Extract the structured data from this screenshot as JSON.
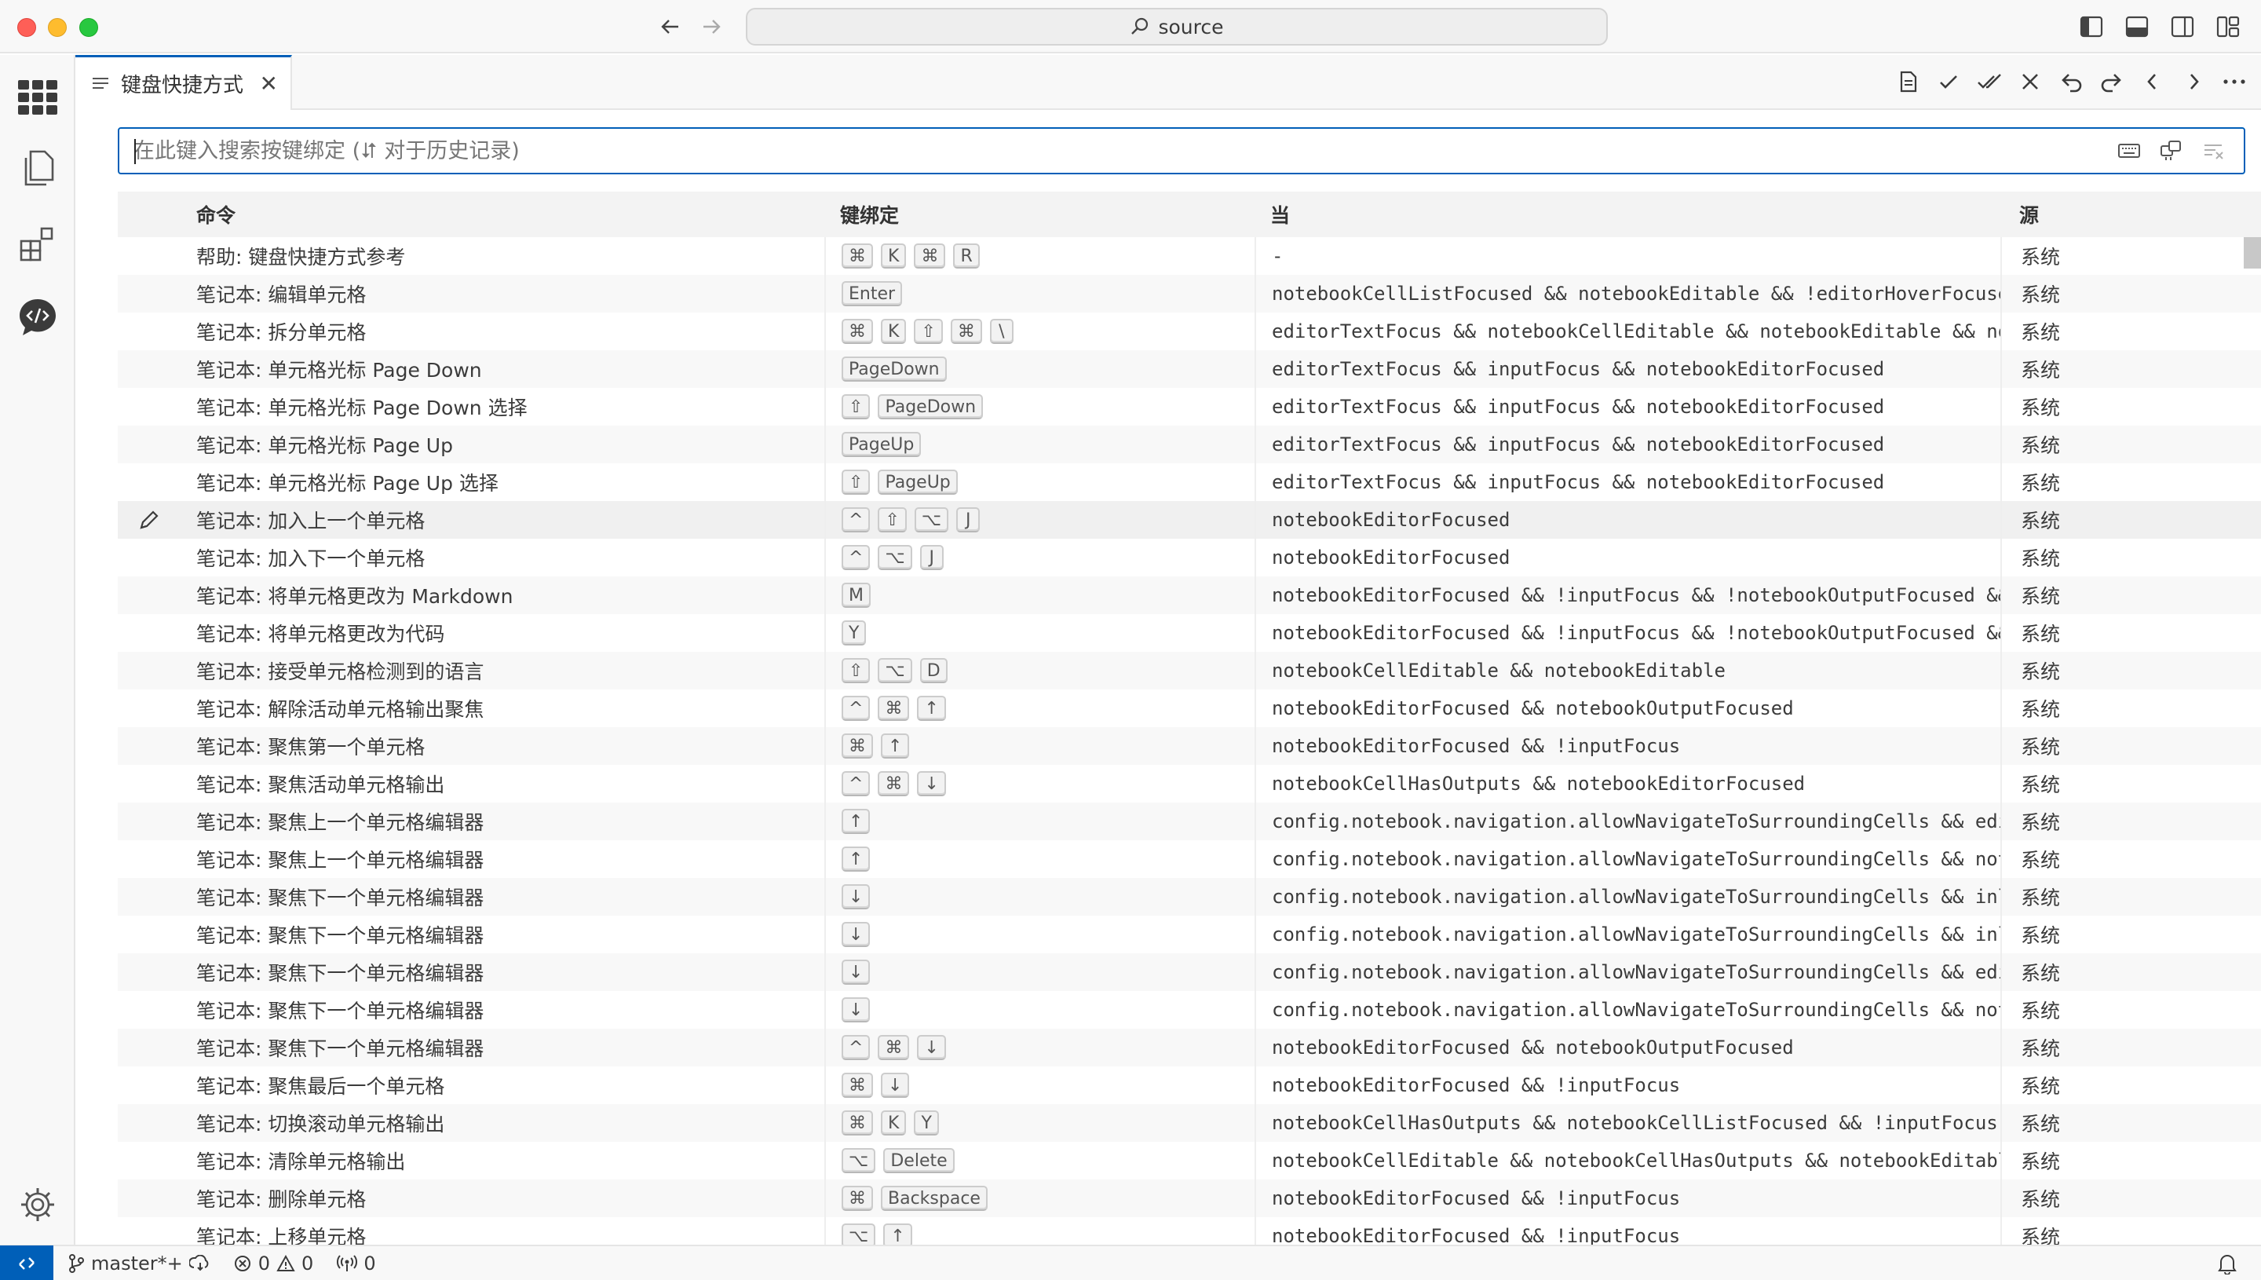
{
  "window": {
    "command_center": "source"
  },
  "tab": {
    "title": "键盘快捷方式"
  },
  "search": {
    "placeholder": "在此键入搜索按键绑定 (⮃ 对于历史记录)",
    "value": ""
  },
  "table": {
    "headers": {
      "command": "命令",
      "keybinding": "键绑定",
      "when": "当",
      "source": "源"
    },
    "rows": [
      {
        "command": "帮助: 键盘快捷方式参考",
        "keys": [
          "⌘",
          "K",
          "⌘",
          "R"
        ],
        "when": "-",
        "source": "系统"
      },
      {
        "command": "笔记本: 编辑单元格",
        "keys": [
          "Enter"
        ],
        "when": "notebookCellListFocused && notebookEditable && !editorHoverFocuse…",
        "source": "系统"
      },
      {
        "command": "笔记本: 拆分单元格",
        "keys": [
          "⌘",
          "K",
          "⇧",
          "⌘",
          "\\"
        ],
        "when": "editorTextFocus && notebookCellEditable && notebookEditable && no…",
        "source": "系统"
      },
      {
        "command": "笔记本: 单元格光标 Page Down",
        "keys": [
          "PageDown"
        ],
        "when": "editorTextFocus && inputFocus && notebookEditorFocused",
        "source": "系统"
      },
      {
        "command": "笔记本: 单元格光标 Page Down 选择",
        "keys": [
          "⇧",
          "PageDown"
        ],
        "when": "editorTextFocus && inputFocus && notebookEditorFocused",
        "source": "系统"
      },
      {
        "command": "笔记本: 单元格光标 Page Up",
        "keys": [
          "PageUp"
        ],
        "when": "editorTextFocus && inputFocus && notebookEditorFocused",
        "source": "系统"
      },
      {
        "command": "笔记本: 单元格光标 Page Up 选择",
        "keys": [
          "⇧",
          "PageUp"
        ],
        "when": "editorTextFocus && inputFocus && notebookEditorFocused",
        "source": "系统"
      },
      {
        "command": "笔记本: 加入上一个单元格",
        "keys": [
          "^",
          "⇧",
          "⌥",
          "J"
        ],
        "when": "notebookEditorFocused",
        "source": "系统"
      },
      {
        "command": "笔记本: 加入下一个单元格",
        "keys": [
          "^",
          "⌥",
          "J"
        ],
        "when": "notebookEditorFocused",
        "source": "系统"
      },
      {
        "command": "笔记本: 将单元格更改为 Markdown",
        "keys": [
          "M"
        ],
        "when": "notebookEditorFocused && !inputFocus && !notebookOutputFocused &&…",
        "source": "系统"
      },
      {
        "command": "笔记本: 将单元格更改为代码",
        "keys": [
          "Y"
        ],
        "when": "notebookEditorFocused && !inputFocus && !notebookOutputFocused &&…",
        "source": "系统"
      },
      {
        "command": "笔记本: 接受单元格检测到的语言",
        "keys": [
          "⇧",
          "⌥",
          "D"
        ],
        "when": "notebookCellEditable && notebookEditable",
        "source": "系统"
      },
      {
        "command": "笔记本: 解除活动单元格输出聚焦",
        "keys": [
          "^",
          "⌘",
          "↑"
        ],
        "when": "notebookEditorFocused && notebookOutputFocused",
        "source": "系统"
      },
      {
        "command": "笔记本: 聚焦第一个单元格",
        "keys": [
          "⌘",
          "↑"
        ],
        "when": "notebookEditorFocused && !inputFocus",
        "source": "系统"
      },
      {
        "command": "笔记本: 聚焦活动单元格输出",
        "keys": [
          "^",
          "⌘",
          "↓"
        ],
        "when": "notebookCellHasOutputs && notebookEditorFocused",
        "source": "系统"
      },
      {
        "command": "笔记本: 聚焦上一个单元格编辑器",
        "keys": [
          "↑"
        ],
        "when": "config.notebook.navigation.allowNavigateToSurroundingCells && edi…",
        "source": "系统"
      },
      {
        "command": "笔记本: 聚焦上一个单元格编辑器",
        "keys": [
          "↑"
        ],
        "when": "config.notebook.navigation.allowNavigateToSurroundingCells && not…",
        "source": "系统"
      },
      {
        "command": "笔记本: 聚焦下一个单元格编辑器",
        "keys": [
          "↓"
        ],
        "when": "config.notebook.navigation.allowNavigateToSurroundingCells && inl…",
        "source": "系统"
      },
      {
        "command": "笔记本: 聚焦下一个单元格编辑器",
        "keys": [
          "↓"
        ],
        "when": "config.notebook.navigation.allowNavigateToSurroundingCells && inl…",
        "source": "系统"
      },
      {
        "command": "笔记本: 聚焦下一个单元格编辑器",
        "keys": [
          "↓"
        ],
        "when": "config.notebook.navigation.allowNavigateToSurroundingCells && edi…",
        "source": "系统"
      },
      {
        "command": "笔记本: 聚焦下一个单元格编辑器",
        "keys": [
          "↓"
        ],
        "when": "config.notebook.navigation.allowNavigateToSurroundingCells && not…",
        "source": "系统"
      },
      {
        "command": "笔记本: 聚焦下一个单元格编辑器",
        "keys": [
          "^",
          "⌘",
          "↓"
        ],
        "when": "notebookEditorFocused && notebookOutputFocused",
        "source": "系统"
      },
      {
        "command": "笔记本: 聚焦最后一个单元格",
        "keys": [
          "⌘",
          "↓"
        ],
        "when": "notebookEditorFocused && !inputFocus",
        "source": "系统"
      },
      {
        "command": "笔记本: 切换滚动单元格输出",
        "keys": [
          "⌘",
          "K",
          "Y"
        ],
        "when": "notebookCellHasOutputs && notebookCellListFocused && !inputFocus",
        "source": "系统"
      },
      {
        "command": "笔记本: 清除单元格输出",
        "keys": [
          "⌥",
          "Delete"
        ],
        "when": "notebookCellEditable && notebookCellHasOutputs && notebookEditabl…",
        "source": "系统"
      },
      {
        "command": "笔记本: 删除单元格",
        "keys": [
          "⌘",
          "Backspace"
        ],
        "when": "notebookEditorFocused && !inputFocus",
        "source": "系统"
      },
      {
        "command": "笔记本: 上移单元格",
        "keys": [
          "⌥",
          "↑"
        ],
        "when": "notebookEditorFocused && !inputFocus",
        "source": "系统"
      }
    ]
  },
  "statusbar": {
    "branch": "master*+",
    "errors": "0",
    "warnings": "0",
    "ports": "0"
  },
  "colors": {
    "accent": "#005fb8",
    "close": "#fe5f57",
    "minimize": "#febc2e",
    "maximize": "#28c840"
  }
}
